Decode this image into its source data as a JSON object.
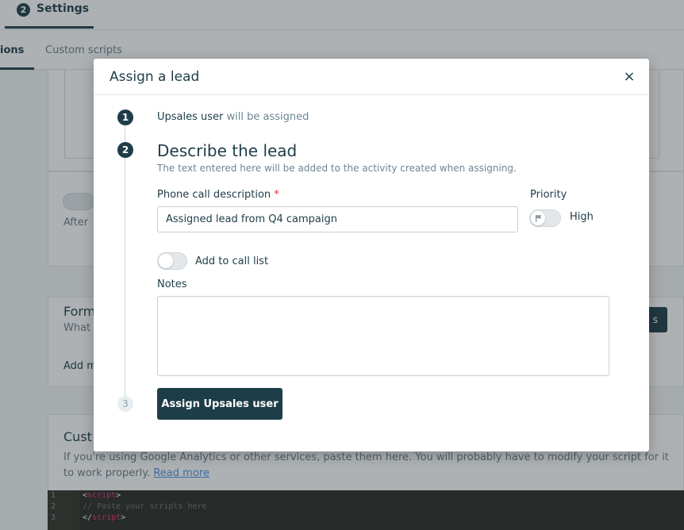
{
  "header": {
    "step_number": "2",
    "step_label": "Settings"
  },
  "subtabs": {
    "active_label": "ions",
    "custom_label": "Custom scripts"
  },
  "background": {
    "after_label": "After",
    "form_title": "Form",
    "form_sub": "What",
    "add_label": "Add m",
    "button_fragment": "s",
    "custom_title": "Cust",
    "custom_desc": "If you're using Google Analytics or other services, paste them here. You will probably have to modify your script for it to work properly.",
    "read_more": "Read more",
    "code_lines": [
      {
        "num": "1",
        "open": "<",
        "tag": "script",
        "close": ">"
      },
      {
        "num": "2",
        "comment": "// Paste your scripts here"
      },
      {
        "num": "3",
        "open": "</",
        "tag": "script",
        "close": ">"
      }
    ]
  },
  "modal": {
    "title": "Assign a lead",
    "close": "×",
    "steps": {
      "one": "1",
      "two": "2",
      "three": "3"
    },
    "step1": {
      "user": "Upsales user",
      "suffix": "will be assigned"
    },
    "step2": {
      "title": "Describe the lead",
      "subtitle": "The text entered here will be added to the activity created when assigning."
    },
    "phone": {
      "label": "Phone call description",
      "required": "*",
      "value": "Assigned lead from Q4 campaign"
    },
    "priority": {
      "label": "Priority",
      "value": "High"
    },
    "call_list": {
      "label": "Add to call list"
    },
    "notes": {
      "label": "Notes",
      "value": ""
    },
    "assign_button": "Assign Upsales user"
  }
}
